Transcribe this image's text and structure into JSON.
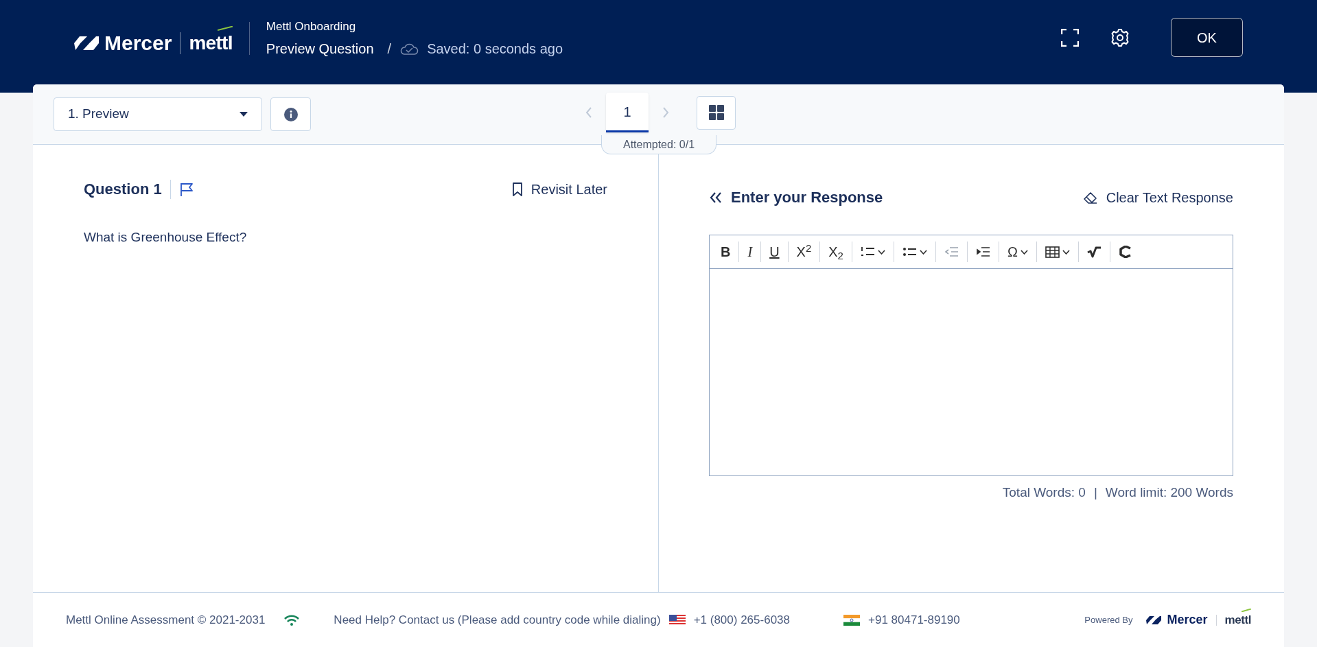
{
  "header": {
    "brand": {
      "mercer": "Mercer",
      "mettl": "mettl"
    },
    "subtitle": "Mettl Onboarding",
    "title": "Preview Question",
    "separator": "/",
    "saved": "Saved: 0 seconds ago",
    "ok_button": "OK"
  },
  "toolbar": {
    "section_select": "1. Preview",
    "pages": [
      {
        "label": "1",
        "selected": true
      }
    ],
    "attempted": "Attempted: 0/1"
  },
  "question": {
    "title": "Question 1",
    "revisit": "Revisit Later",
    "text": "What is Greenhouse Effect?"
  },
  "response": {
    "title": "Enter your Response",
    "clear": "Clear Text Response",
    "tools": [
      {
        "kind": "bold",
        "label": "B",
        "disabled": false
      },
      {
        "kind": "italic",
        "label": "I",
        "disabled": false
      },
      {
        "kind": "underline",
        "label": "U",
        "disabled": false
      },
      {
        "kind": "superscript",
        "label": "X$^{2}$",
        "disabled": false
      },
      {
        "kind": "subscript",
        "label": "X$_{2}$",
        "disabled": false
      },
      {
        "kind": "numbered-list",
        "dropdown": true,
        "disabled": false
      },
      {
        "kind": "bullet-list",
        "dropdown": true,
        "disabled": false
      },
      {
        "kind": "outdent",
        "dropdown": false,
        "disabled": true
      },
      {
        "kind": "indent",
        "dropdown": false,
        "disabled": false
      },
      {
        "kind": "symbol",
        "label": "Ω",
        "dropdown": true,
        "disabled": false
      },
      {
        "kind": "table",
        "dropdown": true,
        "disabled": false
      },
      {
        "kind": "root",
        "dropdown": false,
        "disabled": false
      },
      {
        "kind": "code",
        "dropdown": false,
        "disabled": false
      }
    ],
    "total_words": "Total Words: 0",
    "divider": "|",
    "word_limit": "Word limit: 200 Words"
  },
  "footer": {
    "copyright": "Mettl Online Assessment © 2021-2031",
    "help": "Need Help? Contact us (Please add country code while dialing)",
    "phones": [
      {
        "kind": "us-flag",
        "number": "+1 (800) 265-6038"
      },
      {
        "kind": "india-flag",
        "number": "+91 80471-89190"
      }
    ],
    "powered_by": "Powered By",
    "brand": {
      "mercer": "Mercer",
      "mettl": "mettl"
    }
  }
}
